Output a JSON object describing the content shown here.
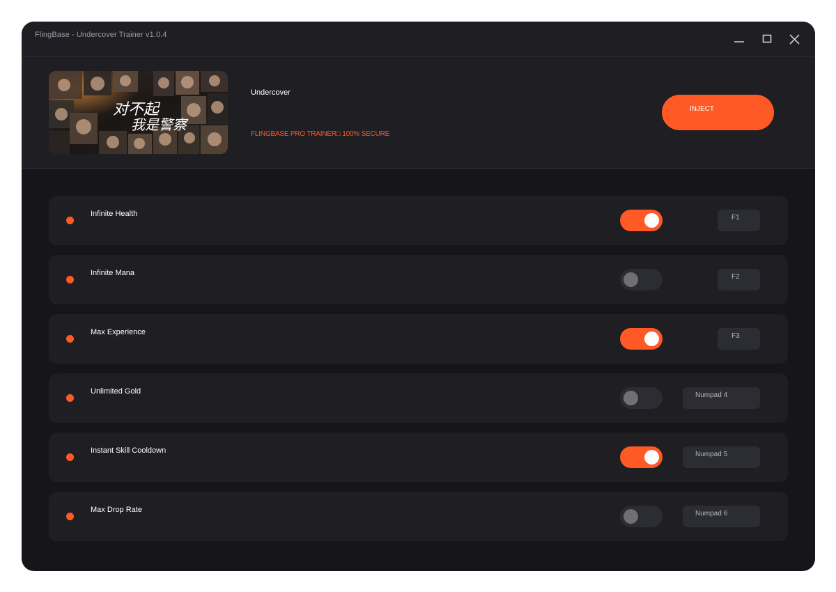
{
  "window": {
    "title": "FlingBase - Undercover Trainer v1.0.4"
  },
  "header": {
    "game_name": "Undercover",
    "tagline": "FLINGBASE PRO TRAINER□ 100% SECURE",
    "inject_label": "INJECT",
    "banner_title_art": "对不起我是警察"
  },
  "colors": {
    "accent": "#ff5a26",
    "background": "#15151a",
    "panel": "#1e1e23",
    "toggle_off": "#2c2c33"
  },
  "cheats": [
    {
      "name": "Infinite Health",
      "enabled": true,
      "hotkey": "F1"
    },
    {
      "name": "Infinite Mana",
      "enabled": false,
      "hotkey": "F2"
    },
    {
      "name": "Max Experience",
      "enabled": true,
      "hotkey": "F3"
    },
    {
      "name": "Unlimited Gold",
      "enabled": false,
      "hotkey": "Numpad 4"
    },
    {
      "name": "Instant Skill Cooldown",
      "enabled": true,
      "hotkey": "Numpad 5"
    },
    {
      "name": "Max Drop Rate",
      "enabled": false,
      "hotkey": "Numpad 6"
    }
  ],
  "icons": {
    "minimize": "minimize-icon",
    "maximize": "maximize-icon",
    "close": "close-icon"
  }
}
